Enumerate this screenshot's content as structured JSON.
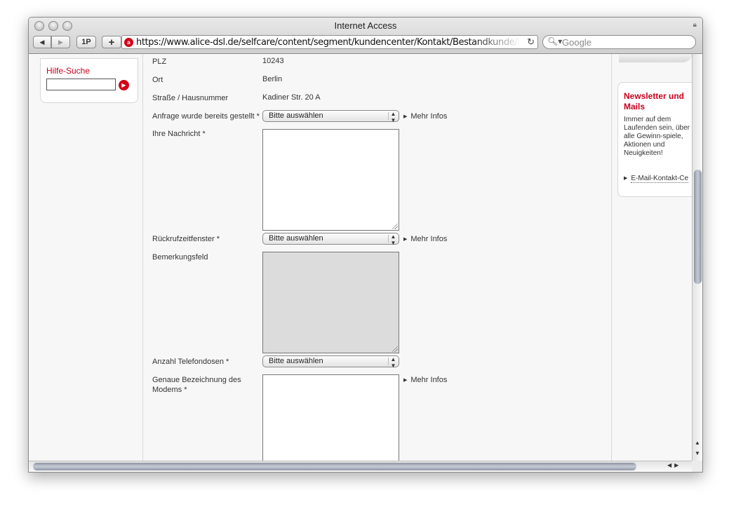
{
  "window": {
    "title": "Internet Access",
    "toolbar": {
      "back_glyph": "◀",
      "forward_glyph": "▶",
      "onepassword_label": "1P",
      "add_label": "+",
      "url": "https://www.alice-dsl.de/selfcare/content/segment/kundencenter/Kontakt/Bestandkunde/Bestandkunde",
      "reload_glyph": "↻",
      "search_placeholder": "Google",
      "search_glyph": "🔍︎▾"
    }
  },
  "sidebar": {
    "hilfe_title": "Hilfe-Suche",
    "hilfe_input_value": "",
    "go_glyph": "▶"
  },
  "form": {
    "plz_label": "PLZ",
    "plz_value": "10243",
    "ort_label": "Ort",
    "ort_value": "Berlin",
    "strasse_label": "Straße / Hausnummer",
    "strasse_value": "Kadiner Str. 20 A",
    "anfrage_label": "Anfrage wurde bereits gestellt *",
    "anfrage_selected": "Bitte auswählen",
    "nachricht_label": "Ihre Nachricht *",
    "nachricht_value": "",
    "rueckruf_label": "Rückrufzeitfenster *",
    "rueckruf_selected": "Bitte auswählen",
    "bemerkung_label": "Bemerkungsfeld",
    "bemerkung_value": "",
    "telefondosen_label": "Anzahl Telefondosen *",
    "telefondosen_selected": "Bitte auswählen",
    "modem_label": "Genaue Bezeichnung des Modems *",
    "modem_value": "",
    "mehr_infos": "Mehr Infos",
    "select_arrows": "▲▼"
  },
  "newsletter": {
    "title": "Newsletter und Mails",
    "text": "Immer auf dem Laufenden sein, über alle Gewinn-spiele, Aktionen und Neuigkeiten!",
    "link": "E-Mail-Kontakt-Ce"
  }
}
